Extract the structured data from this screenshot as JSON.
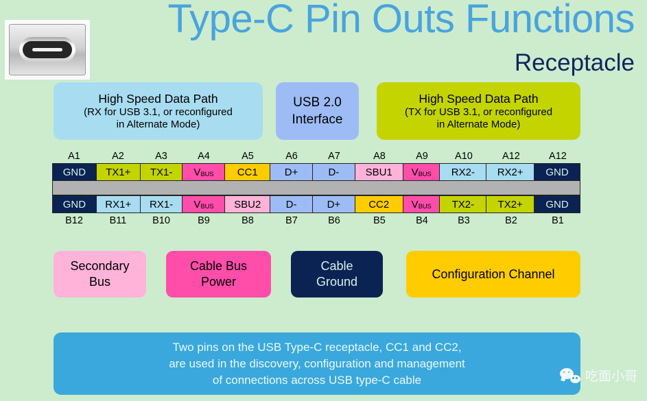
{
  "header": {
    "title": "Type-C Pin Outs Functions",
    "subtitle": "Receptacle",
    "connector_icon": "usb-type-c-receptacle-icon",
    "title_color": "#4aa3dd",
    "subtitle_color": "#10265c"
  },
  "background_color": "#cceccd",
  "callouts": [
    {
      "id": "rx",
      "line1": "High Speed Data Path",
      "line2": "(RX for USB 3.1, or reconfigured",
      "line3": "in Alternate Mode)",
      "color": "#a8dcf0"
    },
    {
      "id": "usb2",
      "line1": "USB 2.0",
      "line2": "Interface",
      "line3": "",
      "color": "#9dbcf5"
    },
    {
      "id": "tx",
      "line1": "High Speed Data Path",
      "line2": "(TX for USB 3.1, or reconfigured",
      "line3": "in Alternate Mode)",
      "color": "#c4d400"
    }
  ],
  "pin_table": {
    "divider_color": "#b2b2b2",
    "row_a": {
      "labels": [
        "A1",
        "A2",
        "A3",
        "A4",
        "A5",
        "A6",
        "A7",
        "A8",
        "A9",
        "A10",
        "A12",
        "A12"
      ],
      "cells": [
        {
          "name": "GND",
          "sub": "",
          "bg": "#0b2352",
          "fg": "#d7f0ea"
        },
        {
          "name": "TX1+",
          "sub": "",
          "bg": "#c4d400",
          "fg": "#000000"
        },
        {
          "name": "TX1-",
          "sub": "",
          "bg": "#c4d400",
          "fg": "#000000"
        },
        {
          "name": "V",
          "sub": "BUS",
          "bg": "#ff4daa",
          "fg": "#000000"
        },
        {
          "name": "CC1",
          "sub": "",
          "bg": "#ffcc00",
          "fg": "#000000"
        },
        {
          "name": "D+",
          "sub": "",
          "bg": "#9dbcf5",
          "fg": "#000000"
        },
        {
          "name": "D-",
          "sub": "",
          "bg": "#9dbcf5",
          "fg": "#000000"
        },
        {
          "name": "SBU1",
          "sub": "",
          "bg": "#ffb3d9",
          "fg": "#000000"
        },
        {
          "name": "V",
          "sub": "BUS",
          "bg": "#ff4daa",
          "fg": "#000000"
        },
        {
          "name": "RX2-",
          "sub": "",
          "bg": "#a8dcf0",
          "fg": "#000000"
        },
        {
          "name": "RX2+",
          "sub": "",
          "bg": "#a8dcf0",
          "fg": "#000000"
        },
        {
          "name": "GND",
          "sub": "",
          "bg": "#0b2352",
          "fg": "#d7f0ea"
        }
      ]
    },
    "row_b": {
      "labels": [
        "B12",
        "B11",
        "B10",
        "B9",
        "B8",
        "B7",
        "B6",
        "B5",
        "B4",
        "B3",
        "B2",
        "B1"
      ],
      "cells": [
        {
          "name": "GND",
          "sub": "",
          "bg": "#0b2352",
          "fg": "#d7f0ea"
        },
        {
          "name": "RX1+",
          "sub": "",
          "bg": "#a8dcf0",
          "fg": "#000000"
        },
        {
          "name": "RX1-",
          "sub": "",
          "bg": "#a8dcf0",
          "fg": "#000000"
        },
        {
          "name": "V",
          "sub": "BUS",
          "bg": "#ff4daa",
          "fg": "#000000"
        },
        {
          "name": "SBU2",
          "sub": "",
          "bg": "#ffb3d9",
          "fg": "#000000"
        },
        {
          "name": "D-",
          "sub": "",
          "bg": "#9dbcf5",
          "fg": "#000000"
        },
        {
          "name": "D+",
          "sub": "",
          "bg": "#9dbcf5",
          "fg": "#000000"
        },
        {
          "name": "CC2",
          "sub": "",
          "bg": "#ffcc00",
          "fg": "#000000"
        },
        {
          "name": "V",
          "sub": "BUS",
          "bg": "#ff4daa",
          "fg": "#000000"
        },
        {
          "name": "TX2-",
          "sub": "",
          "bg": "#c4d400",
          "fg": "#000000"
        },
        {
          "name": "TX2+",
          "sub": "",
          "bg": "#c4d400",
          "fg": "#000000"
        },
        {
          "name": "GND",
          "sub": "",
          "bg": "#0b2352",
          "fg": "#d7f0ea"
        }
      ]
    }
  },
  "legend": [
    {
      "id": "secondary-bus",
      "line1": "Secondary",
      "line2": "Bus",
      "color": "#ffb3d9",
      "text_color": "#000000"
    },
    {
      "id": "cable-bus-power",
      "line1": "Cable Bus",
      "line2": "Power",
      "color": "#ff4daa",
      "text_color": "#000000"
    },
    {
      "id": "cable-ground",
      "line1": "Cable",
      "line2": "Ground",
      "color": "#0b2352",
      "text_color": "#d7f0ea"
    },
    {
      "id": "configuration-channel",
      "line1": "Configuration Channel",
      "line2": "",
      "color": "#ffcc00",
      "text_color": "#000000"
    }
  ],
  "note": {
    "line1": "Two pins on the USB Type-C receptacle, CC1 and CC2,",
    "line2": "are used in the discovery, configuration and management",
    "line3": "of connections across USB type-C cable",
    "color": "#3aa8dc"
  },
  "watermark": {
    "icon": "wechat-icon",
    "label": "吃面小哥"
  }
}
